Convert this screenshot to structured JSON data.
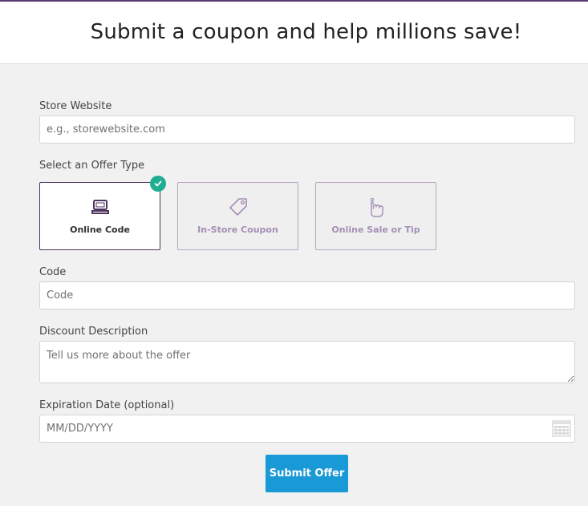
{
  "header": {
    "title": "Submit a coupon and help millions save!"
  },
  "store_website": {
    "label": "Store Website",
    "placeholder": "e.g., storewebsite.com"
  },
  "offer_type": {
    "label": "Select an Offer Type",
    "options": [
      {
        "label": "Online Code",
        "icon": "laptop-icon",
        "selected": true
      },
      {
        "label": "In-Store Coupon",
        "icon": "tag-icon",
        "selected": false
      },
      {
        "label": "Online Sale or Tip",
        "icon": "hand-pointer-icon",
        "selected": false
      }
    ]
  },
  "code": {
    "label": "Code",
    "placeholder": "Code"
  },
  "discount": {
    "label": "Discount Description",
    "placeholder": "Tell us more about the offer"
  },
  "expiration": {
    "label": "Expiration Date (optional)",
    "placeholder": "MM/DD/YYYY",
    "icon": "calendar-icon"
  },
  "submit": {
    "label": "Submit Offer"
  },
  "colors": {
    "accent": "#5b3a6e",
    "button": "#1999d6",
    "check": "#1fae91"
  }
}
